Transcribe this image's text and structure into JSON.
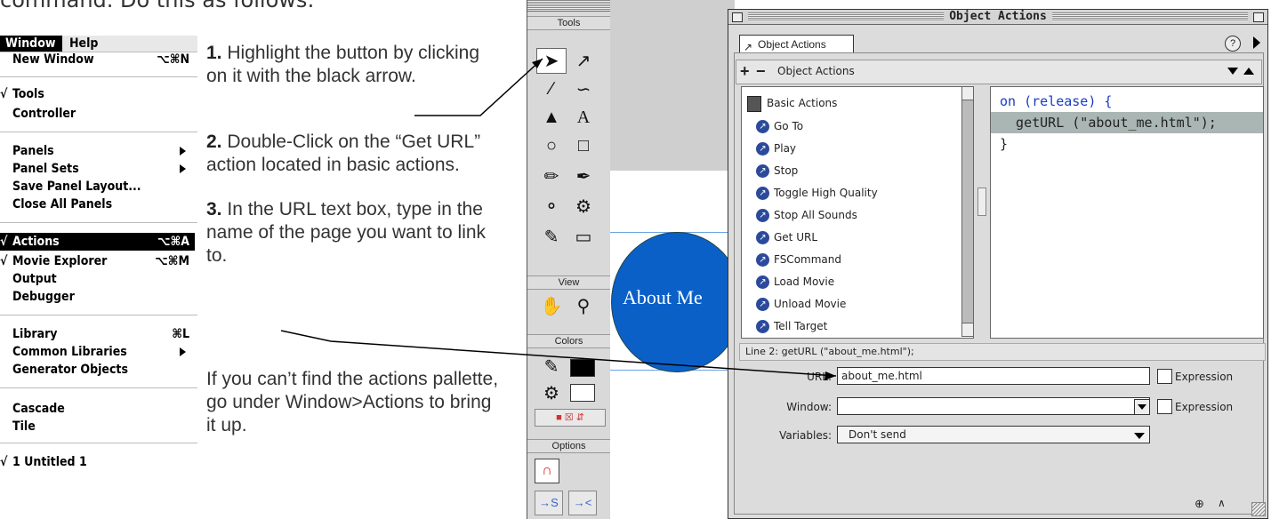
{
  "doc": {
    "top_text": "command. Do this as follows:",
    "steps": [
      {
        "num": "1.",
        "text": "Highlight the button by clicking on it with the black arrow."
      },
      {
        "num": "2.",
        "text": "Double-Click on the “Get URL” action located in basic actions."
      },
      {
        "num": "3.",
        "text": "In the URL text box, type in the name of the page you want to link to."
      }
    ],
    "note": "If you can’t find the actions pallette, go under Window>Actions to bring it up."
  },
  "menu": {
    "bar": [
      "Window",
      "Help"
    ],
    "items": [
      {
        "label": "New Window",
        "shortcut": "⌥⌘N"
      },
      {
        "label": "Tools",
        "check": "√"
      },
      {
        "label": "Controller"
      },
      {
        "label": "Panels"
      },
      {
        "label": "Panel Sets"
      },
      {
        "label": "Save Panel Layout..."
      },
      {
        "label": "Close All Panels"
      },
      {
        "label": "Actions",
        "check": "√",
        "shortcut": "⌥⌘A"
      },
      {
        "label": "Movie Explorer",
        "check": "√",
        "shortcut": "⌥⌘M"
      },
      {
        "label": "Output"
      },
      {
        "label": "Debugger"
      },
      {
        "label": "Library",
        "shortcut": "⌘L"
      },
      {
        "label": "Common Libraries"
      },
      {
        "label": "Generator Objects"
      },
      {
        "label": "Cascade"
      },
      {
        "label": "Tile"
      },
      {
        "label": "1 Untitled 1",
        "check": "√"
      }
    ]
  },
  "tools": {
    "title": "Tools",
    "view": "View",
    "colors": "Colors",
    "options": "Options"
  },
  "stage": {
    "button_label": "About Me"
  },
  "actions_window": {
    "title": "Object Actions",
    "tab": "Object Actions",
    "toolbar_label": "Object Actions",
    "help": "?",
    "plus": "+",
    "minus": "−",
    "category": "Basic Actions",
    "actions": [
      "Go To",
      "Play",
      "Stop",
      "Toggle High Quality",
      "Stop All Sounds",
      "Get URL",
      "FSCommand",
      "Load Movie",
      "Unload Movie",
      "Tell Target"
    ],
    "code": [
      "on (release) {",
      "  getURL (\"about_me.html\");",
      "}"
    ],
    "status": "Line 2: getURL (\"about_me.html\");",
    "url_label": "URL:",
    "url_value": "about_me.html",
    "window_label": "Window:",
    "variables_label": "Variables:",
    "variables_value": "Don't send",
    "expression": "Expression",
    "action_icon": "↗"
  },
  "colors": {
    "accent_blue": "#0b60c8",
    "code_blue": "#1a3cc0"
  }
}
